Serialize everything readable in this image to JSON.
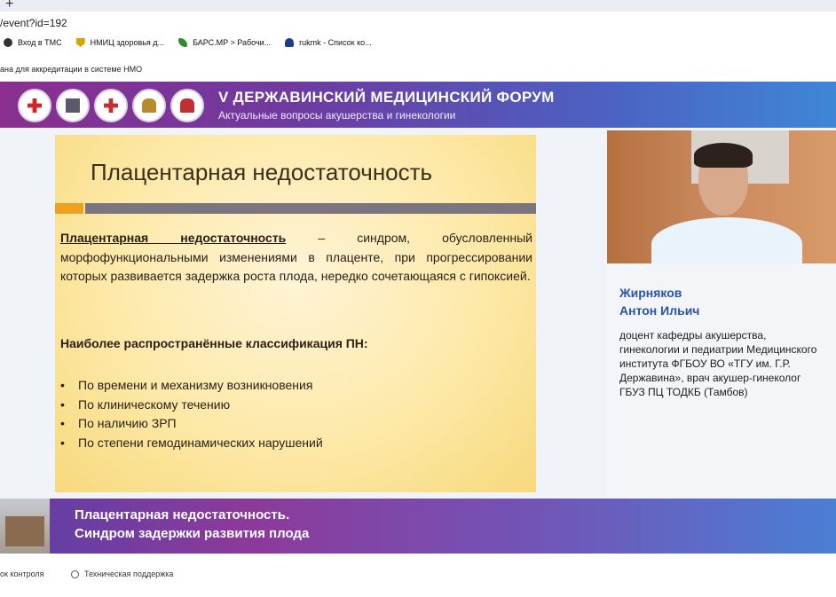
{
  "browser": {
    "new_tab": "+",
    "url": "/event?id=192",
    "bookmarks": [
      {
        "label": "Вход в ТМС",
        "icon": "globe-icon"
      },
      {
        "label": "НМИЦ здоровья д...",
        "icon": "shield-icon"
      },
      {
        "label": "БАРС.MP > Рабочи...",
        "icon": "leaf-icon"
      },
      {
        "label": "rukmk - Список ко...",
        "icon": "people-icon"
      }
    ],
    "infobar": "ана для аккредитации в системе НМО"
  },
  "forum": {
    "title": "V ДЕРЖАВИНСКИЙ МЕДИЦИНСКИЙ ФОРУМ",
    "subtitle": "Актуальные вопросы акушерства и гинекологии"
  },
  "slide": {
    "title": "Плацентарная недостаточность",
    "term": "Плацентарная недостаточность",
    "definition": " – синдром, обусловленный морфофункциональными изменениями в плаценте, при прогрессировании которых развивается задержка роста плода, нередко сочетающаяся с гипоксией.",
    "classification_heading": "Наиболее распространённые классификация ПН:",
    "items": [
      "По времени и механизму возникновения",
      "По клиническому течению",
      "По наличию ЗРП",
      "По степени гемодинамических нарушений"
    ]
  },
  "speaker": {
    "name_line1": "Жирняков",
    "name_line2": "Антон Ильич",
    "info": "доцент кафедры акушерства, гинекологии и педиатрии Медицинского института ФГБОУ ВО «ТГУ им. Г.Р. Державина», врач акушер-гинеколог ГБУЗ ПЦ ТОДКБ (Тамбов)"
  },
  "lower_banner": {
    "line1": "Плацентарная недостаточность.",
    "line2": "Синдром задержки развития плода"
  },
  "footer": {
    "left": "ок контроля",
    "support": "Техническая поддержка"
  }
}
